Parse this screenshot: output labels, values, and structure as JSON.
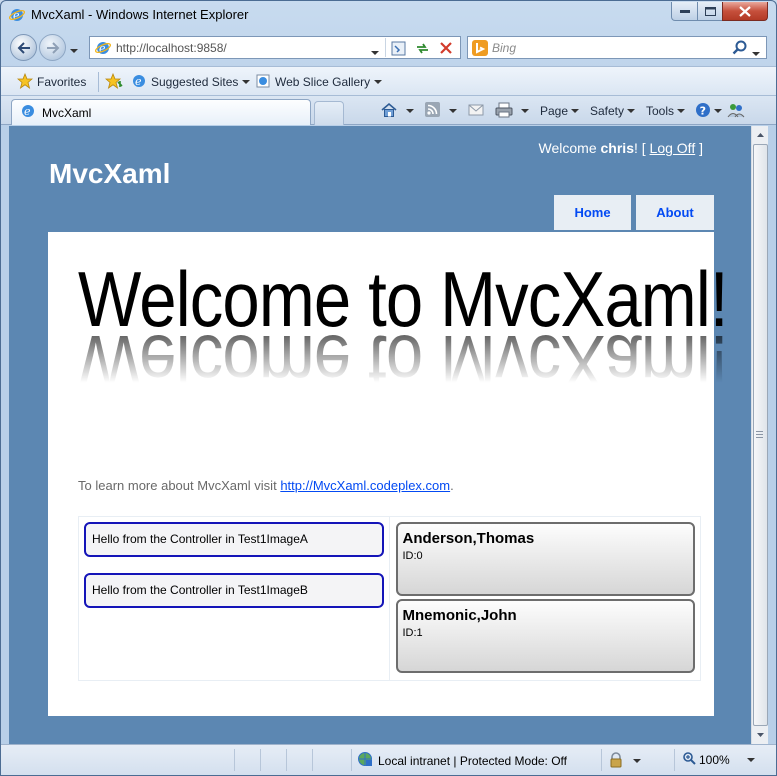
{
  "window": {
    "title": "MvcXaml - Windows Internet Explorer"
  },
  "address": {
    "url": "http://localhost:9858/"
  },
  "search": {
    "placeholder": "Bing"
  },
  "favorites_bar": {
    "favorites_label": "Favorites",
    "items": [
      {
        "label": "Suggested Sites"
      },
      {
        "label": "Web Slice Gallery"
      }
    ]
  },
  "tabs": [
    {
      "label": "MvcXaml"
    }
  ],
  "command_bar": {
    "page_label": "Page",
    "safety_label": "Safety",
    "tools_label": "Tools"
  },
  "site": {
    "title": "MvcXaml",
    "welcome_prefix": "Welcome",
    "user_name": "chris",
    "welcome_suffix": "! [",
    "logoff_label": "Log Off",
    "welcome_end": "]",
    "menu": [
      {
        "label": "Home"
      },
      {
        "label": "About"
      }
    ]
  },
  "hero": {
    "text": "Welcome to MvcXaml!"
  },
  "learn": {
    "prefix": "To learn more about MvcXaml visit",
    "link": "http://MvcXaml.codeplex.com",
    "suffix": "."
  },
  "messages": [
    {
      "text": "Hello from the Controller in Test1ImageA"
    },
    {
      "text": "Hello from the Controller in Test1ImageB"
    }
  ],
  "people": [
    {
      "name": "Anderson,Thomas",
      "id_text": "ID:0"
    },
    {
      "name": "Mnemonic,John",
      "id_text": "ID:1"
    }
  ],
  "status": {
    "zone_text": "Local intranet | Protected Mode: Off",
    "zoom_text": "100%"
  }
}
